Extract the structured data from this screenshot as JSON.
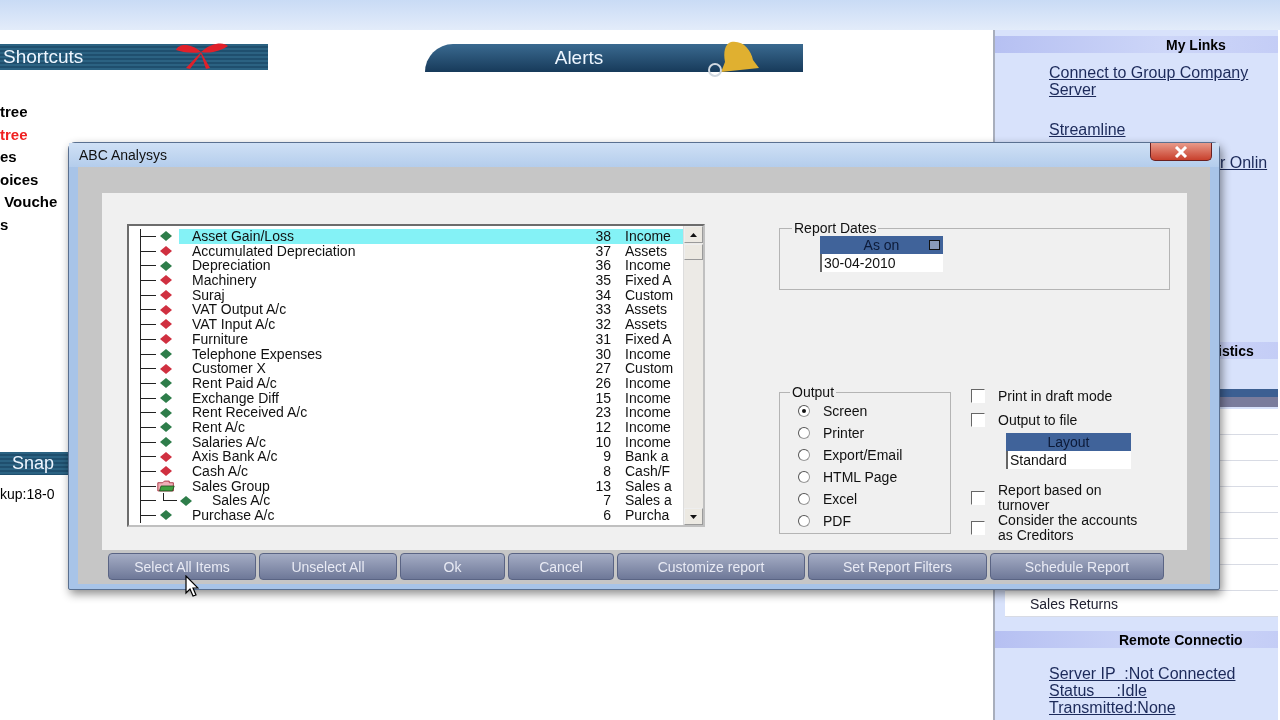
{
  "background": {
    "shortcuts_title": "Shortcuts",
    "alerts_title": "Alerts",
    "shortcut_items": [
      {
        "label": "tree",
        "color": "#000000"
      },
      {
        "label": "tree",
        "color": "#f02020"
      },
      {
        "label": "es",
        "color": "#000000"
      },
      {
        "label": "oices",
        "color": "#000000"
      },
      {
        "label": " Vouche",
        "color": "#000000"
      },
      {
        "label": "s",
        "color": "#000000"
      }
    ],
    "snap_title": "Snap",
    "snap_text": "kup:18-0"
  },
  "right_panel": {
    "my_links_title": "My Links",
    "links": [
      "Connect to Group Company Server",
      "Streamline",
      "r Onlin"
    ],
    "statistics_title": "istics",
    "statistics_items": [
      "Sales Returns"
    ],
    "remote_title": "Remote Connectio",
    "remote_lines": [
      "Server IP  :Not Connected",
      "Status     :Idle",
      "Transmitted:None"
    ]
  },
  "dialog": {
    "title": "ABC Analysys",
    "accounts": [
      {
        "kind": "account",
        "name": "Asset Gain/Loss",
        "number": "38",
        "group": "Income",
        "color": "#2e7d4a",
        "selected": true
      },
      {
        "kind": "account",
        "name": "Accumulated Depreciation",
        "number": "37",
        "group": "Assets",
        "color": "#d03040",
        "selected": false
      },
      {
        "kind": "account",
        "name": "Depreciation",
        "number": "36",
        "group": "Income",
        "color": "#2e7d4a",
        "selected": false
      },
      {
        "kind": "account",
        "name": "Machinery",
        "number": "35",
        "group": "Fixed A",
        "color": "#d03040",
        "selected": false
      },
      {
        "kind": "account",
        "name": "Suraj",
        "number": "34",
        "group": "Custom",
        "color": "#d03040",
        "selected": false
      },
      {
        "kind": "account",
        "name": "VAT Output A/c",
        "number": "33",
        "group": "Assets",
        "color": "#d03040",
        "selected": false
      },
      {
        "kind": "account",
        "name": "VAT Input A/c",
        "number": "32",
        "group": "Assets",
        "color": "#d03040",
        "selected": false
      },
      {
        "kind": "account",
        "name": "Furniture",
        "number": "31",
        "group": "Fixed A",
        "color": "#d03040",
        "selected": false
      },
      {
        "kind": "account",
        "name": "Telephone Expenses",
        "number": "30",
        "group": "Income",
        "color": "#2e7d4a",
        "selected": false
      },
      {
        "kind": "account",
        "name": "Customer X",
        "number": "27",
        "group": "Custom",
        "color": "#d03040",
        "selected": false
      },
      {
        "kind": "account",
        "name": "Rent Paid A/c",
        "number": "26",
        "group": "Income",
        "color": "#2e7d4a",
        "selected": false
      },
      {
        "kind": "account",
        "name": "Exchange Diff",
        "number": "15",
        "group": "Income",
        "color": "#2e7d4a",
        "selected": false
      },
      {
        "kind": "account",
        "name": "Rent Received A/c",
        "number": "23",
        "group": "Income",
        "color": "#2e7d4a",
        "selected": false
      },
      {
        "kind": "account",
        "name": "Rent A/c",
        "number": "12",
        "group": "Income",
        "color": "#2e7d4a",
        "selected": false
      },
      {
        "kind": "account",
        "name": "Salaries A/c",
        "number": "10",
        "group": "Income",
        "color": "#2e7d4a",
        "selected": false
      },
      {
        "kind": "account",
        "name": "Axis Bank A/c",
        "number": "9",
        "group": "Bank a",
        "color": "#d03040",
        "selected": false
      },
      {
        "kind": "account",
        "name": "Cash A/c",
        "number": "8",
        "group": "Cash/F",
        "color": "#d03040",
        "selected": false
      },
      {
        "kind": "group",
        "name": "Sales Group",
        "number": "13",
        "group": "Sales a",
        "selected": false,
        "children": [
          {
            "kind": "account",
            "name": "Sales A/c",
            "number": "7",
            "group": "Sales a",
            "color": "#2e7d4a",
            "selected": false
          }
        ]
      },
      {
        "kind": "account",
        "name": "Purchase A/c",
        "number": "6",
        "group": "Purcha",
        "color": "#2e7d4a",
        "selected": false
      }
    ],
    "report_dates": {
      "legend": "Report Dates",
      "header": "As on",
      "value": "30-04-2010"
    },
    "output": {
      "legend": "Output",
      "options": [
        {
          "label": "Screen",
          "selected": true
        },
        {
          "label": "Printer",
          "selected": false
        },
        {
          "label": "Export/Email",
          "selected": false
        },
        {
          "label": "HTML Page",
          "selected": false
        },
        {
          "label": "Excel",
          "selected": false
        },
        {
          "label": "PDF",
          "selected": false
        }
      ]
    },
    "options": [
      {
        "label": "Print in draft mode",
        "checked": false
      },
      {
        "label": "Output to file",
        "checked": false
      },
      {
        "label": "Report based on turnover",
        "checked": false
      },
      {
        "label": "Consider the accounts as Creditors",
        "checked": false
      }
    ],
    "layout": {
      "header": "Layout",
      "value": "Standard"
    },
    "buttons": [
      "Select All Items",
      "Unselect All",
      "Ok",
      "Cancel",
      "Customize report",
      "Set Report Filters",
      "Schedule Report"
    ]
  }
}
